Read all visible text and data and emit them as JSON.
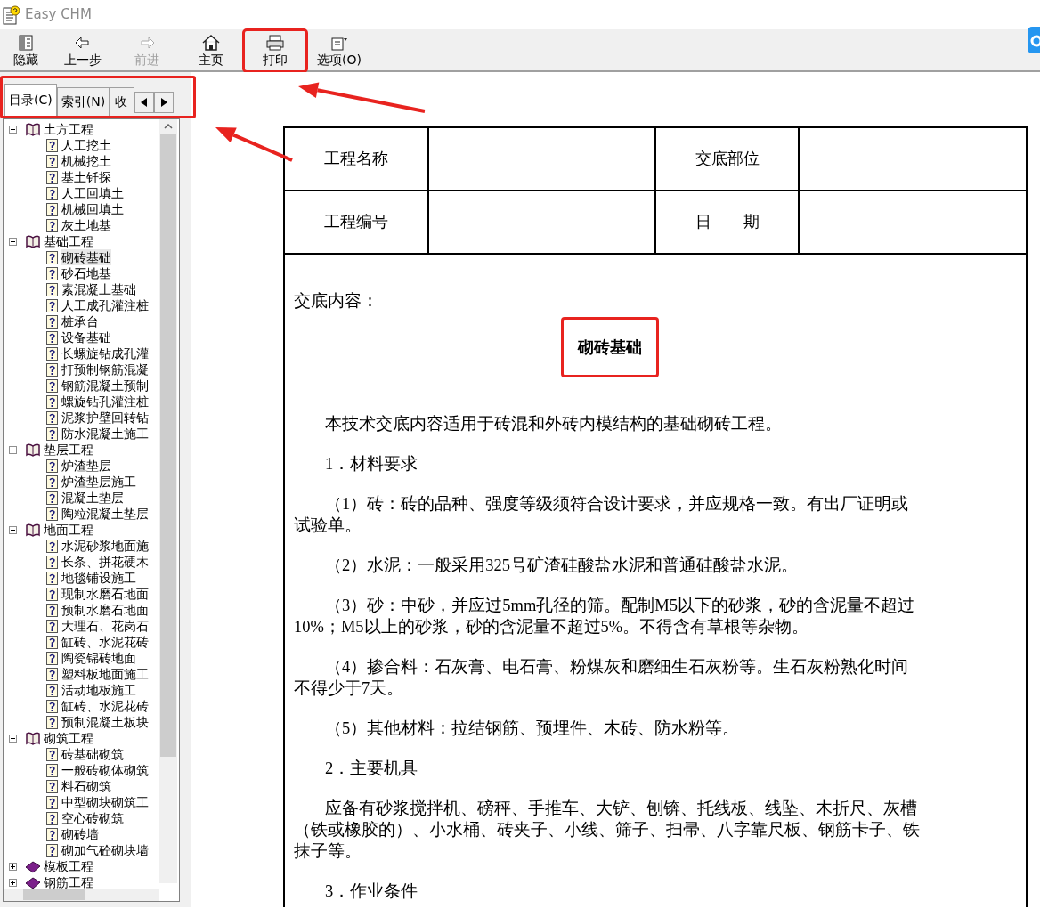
{
  "window": {
    "title": "Easy CHM"
  },
  "toolbar": [
    {
      "label": "隐藏",
      "kind": "hide",
      "disabled": false,
      "highlighted": false
    },
    {
      "label": "上一步",
      "kind": "back",
      "disabled": false,
      "highlighted": false
    },
    {
      "label": "前进",
      "kind": "forward",
      "disabled": true,
      "highlighted": false
    },
    {
      "label": "主页",
      "kind": "home",
      "disabled": false,
      "highlighted": false
    },
    {
      "label": "打印",
      "kind": "print",
      "disabled": false,
      "highlighted": true
    },
    {
      "label": "选项(O)",
      "kind": "options",
      "disabled": false,
      "highlighted": false
    }
  ],
  "nav_tabs": {
    "highlighted": true,
    "tabs": [
      {
        "label": "目录(C)",
        "selected": true
      },
      {
        "label": "索引(N)",
        "selected": false
      },
      {
        "label": "收",
        "selected": false
      }
    ]
  },
  "tree": [
    {
      "label": "土方工程",
      "kind": "book",
      "expanded": true,
      "children": [
        {
          "label": "人工挖土",
          "kind": "page",
          "selected": false
        },
        {
          "label": "机械挖土",
          "kind": "page",
          "selected": false
        },
        {
          "label": "基土钎探",
          "kind": "page",
          "selected": false
        },
        {
          "label": "人工回填土",
          "kind": "page",
          "selected": false
        },
        {
          "label": "机械回填土",
          "kind": "page",
          "selected": false
        },
        {
          "label": "灰土地基",
          "kind": "page",
          "selected": false
        }
      ]
    },
    {
      "label": "基础工程",
      "kind": "book",
      "expanded": true,
      "children": [
        {
          "label": "砌砖基础",
          "kind": "page",
          "selected": true
        },
        {
          "label": "砂石地基",
          "kind": "page",
          "selected": false
        },
        {
          "label": "素混凝土基础",
          "kind": "page",
          "selected": false
        },
        {
          "label": "人工成孔灌注桩",
          "kind": "page",
          "selected": false
        },
        {
          "label": "桩承台",
          "kind": "page",
          "selected": false
        },
        {
          "label": "设备基础",
          "kind": "page",
          "selected": false
        },
        {
          "label": "长螺旋钻成孔灌",
          "kind": "page",
          "selected": false
        },
        {
          "label": "打预制钢筋混凝",
          "kind": "page",
          "selected": false
        },
        {
          "label": "钢筋混凝土预制",
          "kind": "page",
          "selected": false
        },
        {
          "label": "螺旋钻孔灌注桩",
          "kind": "page",
          "selected": false
        },
        {
          "label": "泥浆护壁回转钻",
          "kind": "page",
          "selected": false
        },
        {
          "label": "防水混凝土施工",
          "kind": "page",
          "selected": false
        }
      ]
    },
    {
      "label": "垫层工程",
      "kind": "book",
      "expanded": true,
      "children": [
        {
          "label": "炉渣垫层",
          "kind": "page",
          "selected": false
        },
        {
          "label": "炉渣垫层施工",
          "kind": "page",
          "selected": false
        },
        {
          "label": "混凝土垫层",
          "kind": "page",
          "selected": false
        },
        {
          "label": "陶粒混凝土垫层",
          "kind": "page",
          "selected": false
        }
      ]
    },
    {
      "label": "地面工程",
      "kind": "book",
      "expanded": true,
      "children": [
        {
          "label": "水泥砂浆地面施",
          "kind": "page",
          "selected": false
        },
        {
          "label": "长条、拼花硬木",
          "kind": "page",
          "selected": false
        },
        {
          "label": "地毯铺设施工",
          "kind": "page",
          "selected": false
        },
        {
          "label": "现制水磨石地面",
          "kind": "page",
          "selected": false
        },
        {
          "label": "预制水磨石地面",
          "kind": "page",
          "selected": false
        },
        {
          "label": "大理石、花岗石",
          "kind": "page",
          "selected": false
        },
        {
          "label": "缸砖、水泥花砖",
          "kind": "page",
          "selected": false
        },
        {
          "label": "陶瓷锦砖地面",
          "kind": "page",
          "selected": false
        },
        {
          "label": "塑料板地面施工",
          "kind": "page",
          "selected": false
        },
        {
          "label": "活动地板施工",
          "kind": "page",
          "selected": false
        },
        {
          "label": "缸砖、水泥花砖",
          "kind": "page",
          "selected": false
        },
        {
          "label": "预制混凝土板块",
          "kind": "page",
          "selected": false
        }
      ]
    },
    {
      "label": "砌筑工程",
      "kind": "book",
      "expanded": true,
      "children": [
        {
          "label": "砖基础砌筑",
          "kind": "page",
          "selected": false
        },
        {
          "label": "一般砖砌体砌筑",
          "kind": "page",
          "selected": false
        },
        {
          "label": "料石砌筑",
          "kind": "page",
          "selected": false
        },
        {
          "label": "中型砌块砌筑工",
          "kind": "page",
          "selected": false
        },
        {
          "label": "空心砖砌筑",
          "kind": "page",
          "selected": false
        },
        {
          "label": "砌砖墙",
          "kind": "page",
          "selected": false
        },
        {
          "label": "砌加气砼砌块墙",
          "kind": "page",
          "selected": false
        }
      ]
    },
    {
      "label": "模板工程",
      "kind": "book",
      "expanded": false
    },
    {
      "label": "钢筋工程",
      "kind": "book",
      "expanded": false
    }
  ],
  "document": {
    "header_rows": [
      {
        "label_1": "工程名称",
        "label_2": "交底部位"
      },
      {
        "label_1": "工程编号",
        "label_2": "日　　期"
      }
    ],
    "content_label": "交底内容：",
    "title": "砌砖基础",
    "title_highlighted": true,
    "paragraphs": [
      "本技术交底内容适用于砖混和外砖内模结构的基础砌砖工程。",
      "1．材料要求",
      "（1）砖：砖的品种、强度等级须符合设计要求，并应规格一致。有出厂证明或试验单。",
      "（2）水泥：一般采用325号矿渣硅酸盐水泥和普通硅酸盐水泥。",
      "（3）砂：中砂，并应过5mm孔径的筛。配制M5以下的砂浆，砂的含泥量不超过10%；M5以上的砂浆，砂的含泥量不超过5%。不得含有草根等杂物。",
      "（4）掺合料：石灰膏、电石膏、粉煤灰和磨细生石灰粉等。生石灰粉熟化时间不得少于7天。",
      "（5）其他材料：拉结钢筋、预埋件、木砖、防水粉等。",
      "2．主要机具",
      "应备有砂浆搅拌机、磅秤、手推车、大铲、刨锛、托线板、线坠、木折尺、灰槽（铁或橡胶的）、小水桶、砖夹子、小线、筛子、扫帚、八字靠尺板、钢筋卡子、铁抹子等。",
      "3．作业条件"
    ]
  },
  "annotation_arrows": [
    {
      "kind": "arrow"
    },
    {
      "kind": "arrow"
    }
  ]
}
